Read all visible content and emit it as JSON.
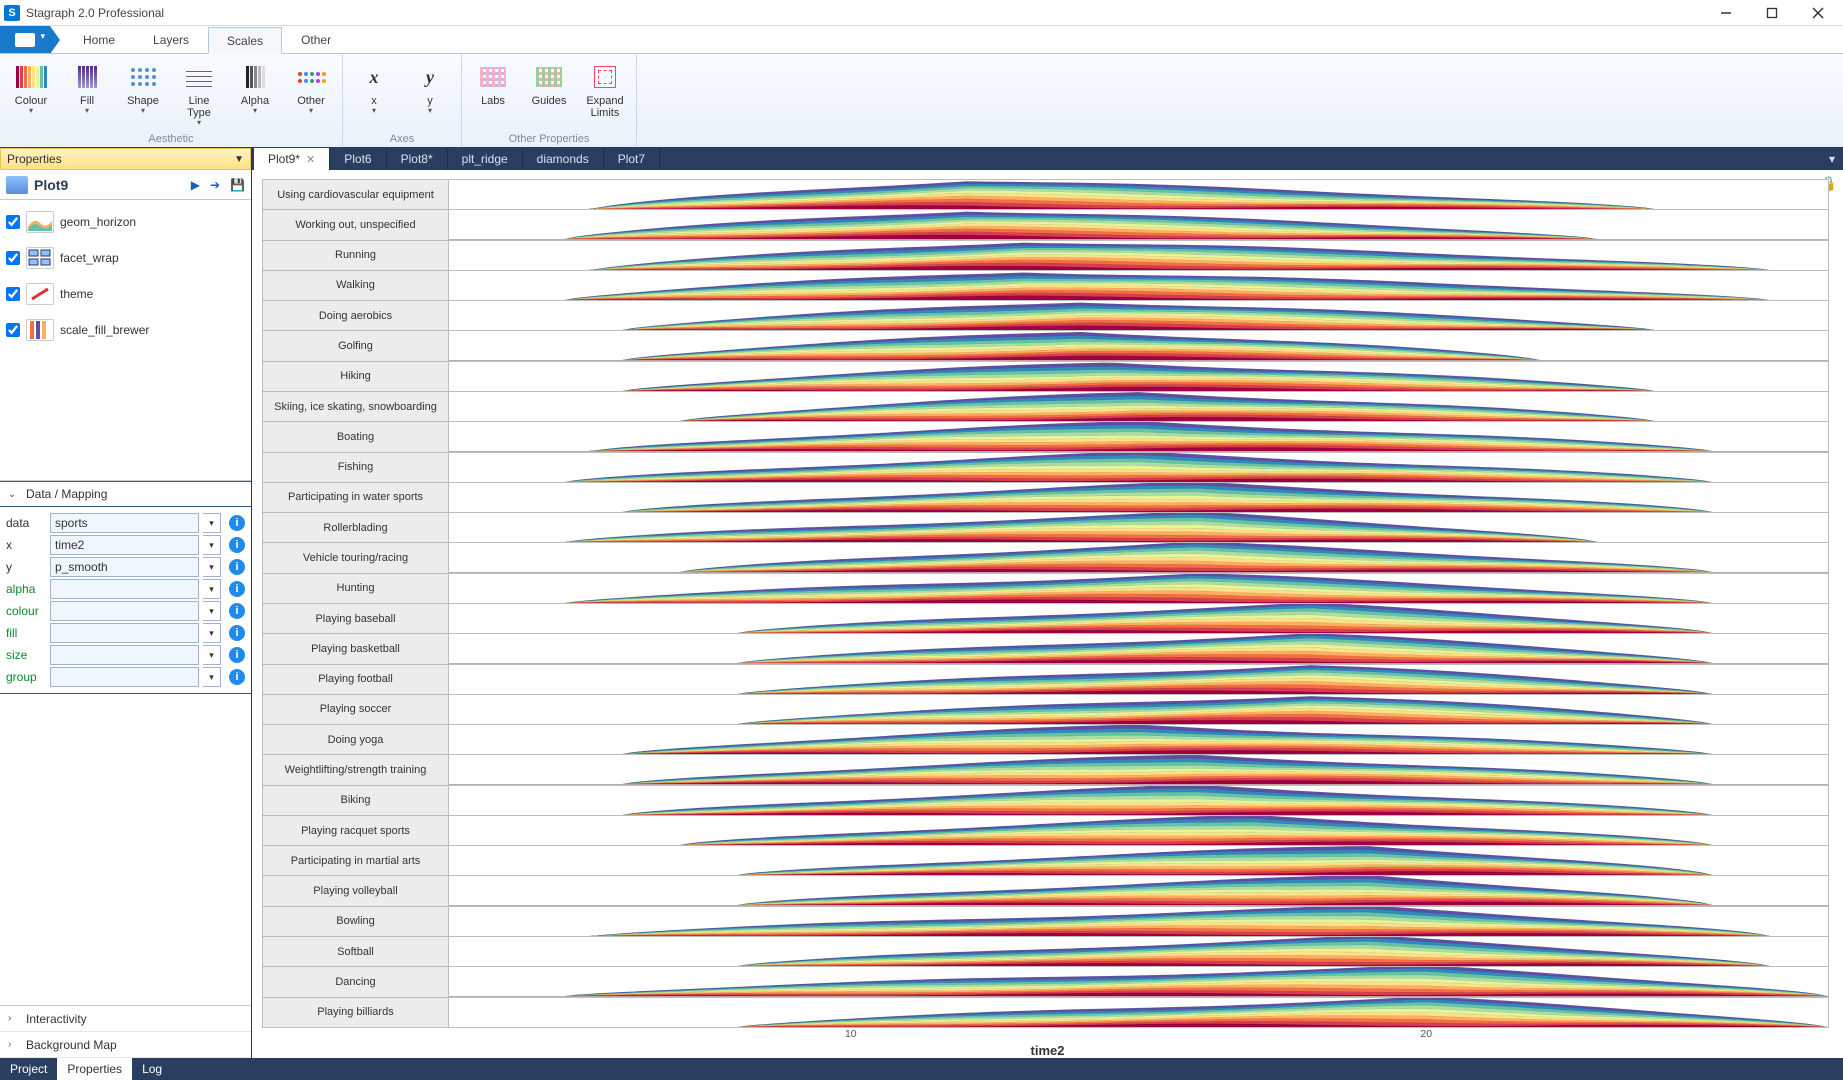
{
  "app": {
    "title": "Stagraph 2.0 Professional"
  },
  "ribbon": {
    "tabs": [
      "Home",
      "Layers",
      "Scales",
      "Other"
    ],
    "active": "Scales",
    "groups": [
      {
        "label": "Aesthetic",
        "items": [
          {
            "label": "Colour",
            "drop": true
          },
          {
            "label": "Fill",
            "drop": true
          },
          {
            "label": "Shape",
            "drop": true
          },
          {
            "label": "Line\nType",
            "drop": true
          },
          {
            "label": "Alpha",
            "drop": true
          },
          {
            "label": "Other",
            "drop": true
          }
        ]
      },
      {
        "label": "Axes",
        "items": [
          {
            "label": "x",
            "drop": true
          },
          {
            "label": "y",
            "drop": true
          }
        ]
      },
      {
        "label": "Other Properties",
        "items": [
          {
            "label": "Labs"
          },
          {
            "label": "Guides"
          },
          {
            "label": "Expand\nLimits"
          }
        ]
      }
    ]
  },
  "side": {
    "header": "Properties",
    "plot_name": "Plot9",
    "layers": [
      {
        "name": "geom_horizon",
        "checked": true
      },
      {
        "name": "facet_wrap",
        "checked": true
      },
      {
        "name": "theme",
        "checked": true
      },
      {
        "name": "scale_fill_brewer",
        "checked": true
      }
    ],
    "sections": {
      "datamap": {
        "title": "Data / Mapping",
        "open": true
      },
      "interactivity": {
        "title": "Interactivity",
        "open": false
      },
      "bgmap": {
        "title": "Background Map",
        "open": false
      }
    },
    "mapping": [
      {
        "key": "data",
        "green": false,
        "value": "sports"
      },
      {
        "key": "x",
        "green": false,
        "value": "time2"
      },
      {
        "key": "y",
        "green": false,
        "value": "p_smooth"
      },
      {
        "key": "alpha",
        "green": true,
        "value": ""
      },
      {
        "key": "colour",
        "green": true,
        "value": ""
      },
      {
        "key": "fill",
        "green": true,
        "value": ""
      },
      {
        "key": "size",
        "green": true,
        "value": ""
      },
      {
        "key": "group",
        "green": true,
        "value": ""
      }
    ]
  },
  "status_tabs": [
    "Project",
    "Properties",
    "Log"
  ],
  "status_active": "Properties",
  "plot_tabs": [
    {
      "label": "Plot9*",
      "active": true,
      "closable": true
    },
    {
      "label": "Plot6"
    },
    {
      "label": "Plot8*"
    },
    {
      "label": "plt_ridge"
    },
    {
      "label": "diamonds"
    },
    {
      "label": "Plot7"
    }
  ],
  "chart_data": {
    "type": "area",
    "xlabel": "time2",
    "ticks": [
      10,
      20
    ],
    "xlim": [
      3,
      27
    ],
    "colors": [
      "#5e4fa2",
      "#3288bd",
      "#66c2a5",
      "#abdda4",
      "#e6f598",
      "#fee08b",
      "#fdae61",
      "#f46d43",
      "#d53e4f",
      "#9e0142"
    ],
    "facets": [
      {
        "label": "Using cardiovascular equipment",
        "start": 5.5,
        "peak": 12,
        "end": 24,
        "skew": 0.2
      },
      {
        "label": "Working out, unspecified",
        "start": 5,
        "peak": 12,
        "end": 23,
        "skew": 0.2
      },
      {
        "label": "Running",
        "start": 5.5,
        "peak": 13,
        "end": 26,
        "skew": 0.1
      },
      {
        "label": "Walking",
        "start": 5,
        "peak": 13,
        "end": 26,
        "skew": 0.05
      },
      {
        "label": "Doing aerobics",
        "start": 6,
        "peak": 14,
        "end": 24,
        "skew": 0.0
      },
      {
        "label": "Golfing",
        "start": 6,
        "peak": 14,
        "end": 22,
        "skew": 0.1
      },
      {
        "label": "Hiking",
        "start": 6,
        "peak": 14.5,
        "end": 24,
        "skew": 0.0
      },
      {
        "label": "Skiing, ice skating, snowboarding",
        "start": 7,
        "peak": 15,
        "end": 24,
        "skew": 0.0
      },
      {
        "label": "Boating",
        "start": 5.5,
        "peak": 15,
        "end": 25,
        "skew": -0.05
      },
      {
        "label": "Fishing",
        "start": 5,
        "peak": 15,
        "end": 25,
        "skew": 0.05
      },
      {
        "label": "Participating in water sports",
        "start": 6,
        "peak": 16,
        "end": 25,
        "skew": -0.1
      },
      {
        "label": "Rollerblading",
        "start": 5,
        "peak": 16,
        "end": 23,
        "skew": -0.1
      },
      {
        "label": "Vehicle touring/racing",
        "start": 7,
        "peak": 16,
        "end": 25,
        "skew": -0.1
      },
      {
        "label": "Hunting",
        "start": 5,
        "peak": 16,
        "end": 25,
        "skew": 0.0
      },
      {
        "label": "Playing baseball",
        "start": 8,
        "peak": 18,
        "end": 25,
        "skew": -0.2
      },
      {
        "label": "Playing basketball",
        "start": 8,
        "peak": 18,
        "end": 25,
        "skew": -0.2
      },
      {
        "label": "Playing football",
        "start": 8,
        "peak": 18,
        "end": 25,
        "skew": -0.2
      },
      {
        "label": "Playing soccer",
        "start": 8,
        "peak": 18,
        "end": 25,
        "skew": -0.2
      },
      {
        "label": "Doing yoga",
        "start": 6,
        "peak": 15,
        "end": 25,
        "skew": 0.0
      },
      {
        "label": "Weightlifting/strength training",
        "start": 6,
        "peak": 16,
        "end": 25,
        "skew": -0.1
      },
      {
        "label": "Biking",
        "start": 6,
        "peak": 16,
        "end": 25,
        "skew": -0.05
      },
      {
        "label": "Playing racquet sports",
        "start": 7,
        "peak": 17,
        "end": 25,
        "skew": -0.15
      },
      {
        "label": "Participating in martial arts",
        "start": 8,
        "peak": 19,
        "end": 25,
        "skew": -0.25
      },
      {
        "label": "Playing volleyball",
        "start": 8,
        "peak": 19,
        "end": 25,
        "skew": -0.25
      },
      {
        "label": "Bowling",
        "start": 5.5,
        "peak": 19,
        "end": 26,
        "skew": -0.3
      },
      {
        "label": "Softball",
        "start": 8,
        "peak": 19,
        "end": 26,
        "skew": -0.25
      },
      {
        "label": "Dancing",
        "start": 5,
        "peak": 20,
        "end": 27,
        "skew": -0.35
      },
      {
        "label": "Playing billiards",
        "start": 8,
        "peak": 20,
        "end": 27,
        "skew": -0.35
      }
    ]
  }
}
